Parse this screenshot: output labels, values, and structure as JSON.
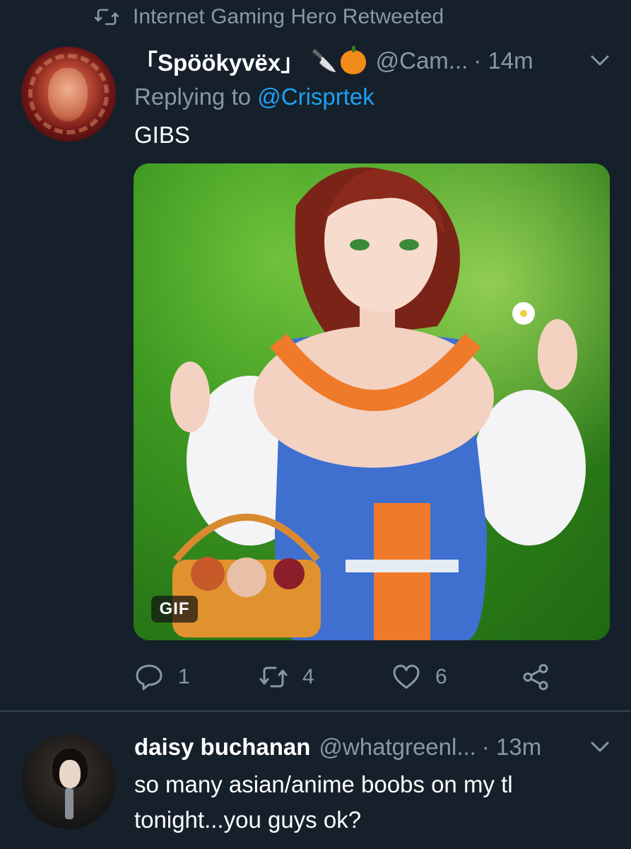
{
  "retweet_banner": {
    "text": "Internet Gaming Hero Retweeted",
    "icon": "retweet-icon"
  },
  "tweet1": {
    "display_name": "「Spöökyvëx」",
    "emoji_1": "🔪",
    "emoji_2": "pumpkin-emoji",
    "handle": "@Cam...",
    "time": "· 14m",
    "replying_prefix": "Replying to ",
    "replying_to": "@Crisprtek",
    "text": "GIBS",
    "media_badge": "GIF",
    "stats": {
      "replies": "1",
      "retweets": "4",
      "likes": "6"
    }
  },
  "tweet2": {
    "display_name": "daisy buchanan",
    "handle": "@whatgreenl...",
    "time": "· 13m",
    "text_line1": "so many asian/anime boobs on my tl",
    "text_line2": "tonight...you guys ok?"
  },
  "colors": {
    "background": "#15202b",
    "secondary_text": "#8899a6",
    "link": "#1da1f2",
    "divider": "#38444d"
  }
}
